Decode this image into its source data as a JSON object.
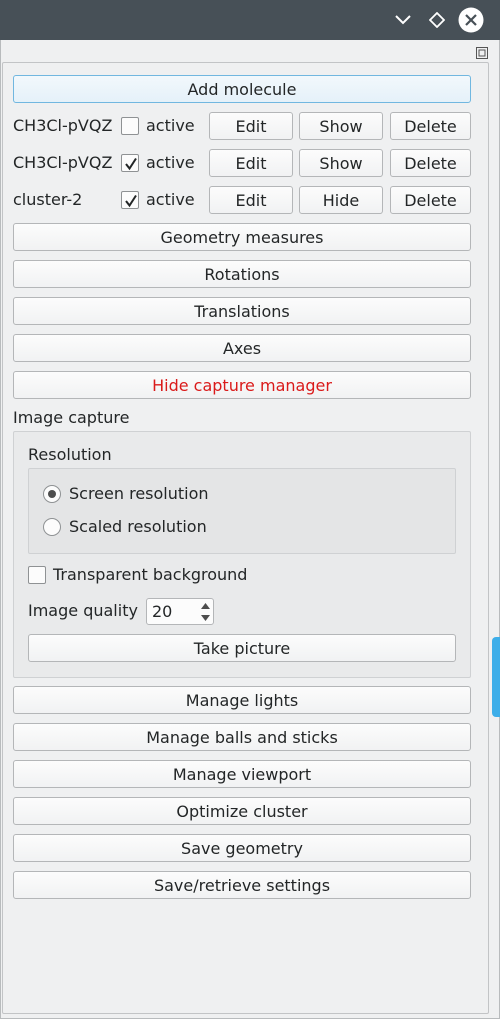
{
  "titlebar": {
    "icons": [
      "chevron-down-icon",
      "diamond-icon",
      "close-icon"
    ]
  },
  "add_molecule_label": "Add molecule",
  "molecules": [
    {
      "name": "CH3Cl-pVQZ",
      "active_label": "active",
      "active": false,
      "edit_label": "Edit",
      "toggle_label": "Show",
      "delete_label": "Delete"
    },
    {
      "name": "CH3Cl-pVQZ",
      "active_label": "active",
      "active": true,
      "edit_label": "Edit",
      "toggle_label": "Show",
      "delete_label": "Delete"
    },
    {
      "name": "cluster-2",
      "active_label": "active",
      "active": true,
      "edit_label": "Edit",
      "toggle_label": "Hide",
      "delete_label": "Delete"
    }
  ],
  "tools": {
    "geometry_measures": "Geometry measures",
    "rotations": "Rotations",
    "translations": "Translations",
    "axes": "Axes",
    "hide_capture_manager": "Hide capture manager"
  },
  "capture": {
    "title": "Image capture",
    "resolution_title": "Resolution",
    "screen_resolution": "Screen resolution",
    "scaled_resolution": "Scaled resolution",
    "selected_resolution": "screen",
    "transparent_background": "Transparent background",
    "transparent_checked": false,
    "image_quality_label": "Image quality",
    "image_quality_value": "20",
    "take_picture": "Take picture"
  },
  "manage": {
    "lights": "Manage lights",
    "balls_and_sticks": "Manage balls and sticks",
    "viewport": "Manage viewport",
    "optimize_cluster": "Optimize cluster",
    "save_geometry": "Save geometry",
    "save_retrieve_settings": "Save/retrieve settings"
  },
  "colors": {
    "titlebar": "#475057",
    "accent": "#3daee9",
    "warning_text": "#da1a1a"
  }
}
